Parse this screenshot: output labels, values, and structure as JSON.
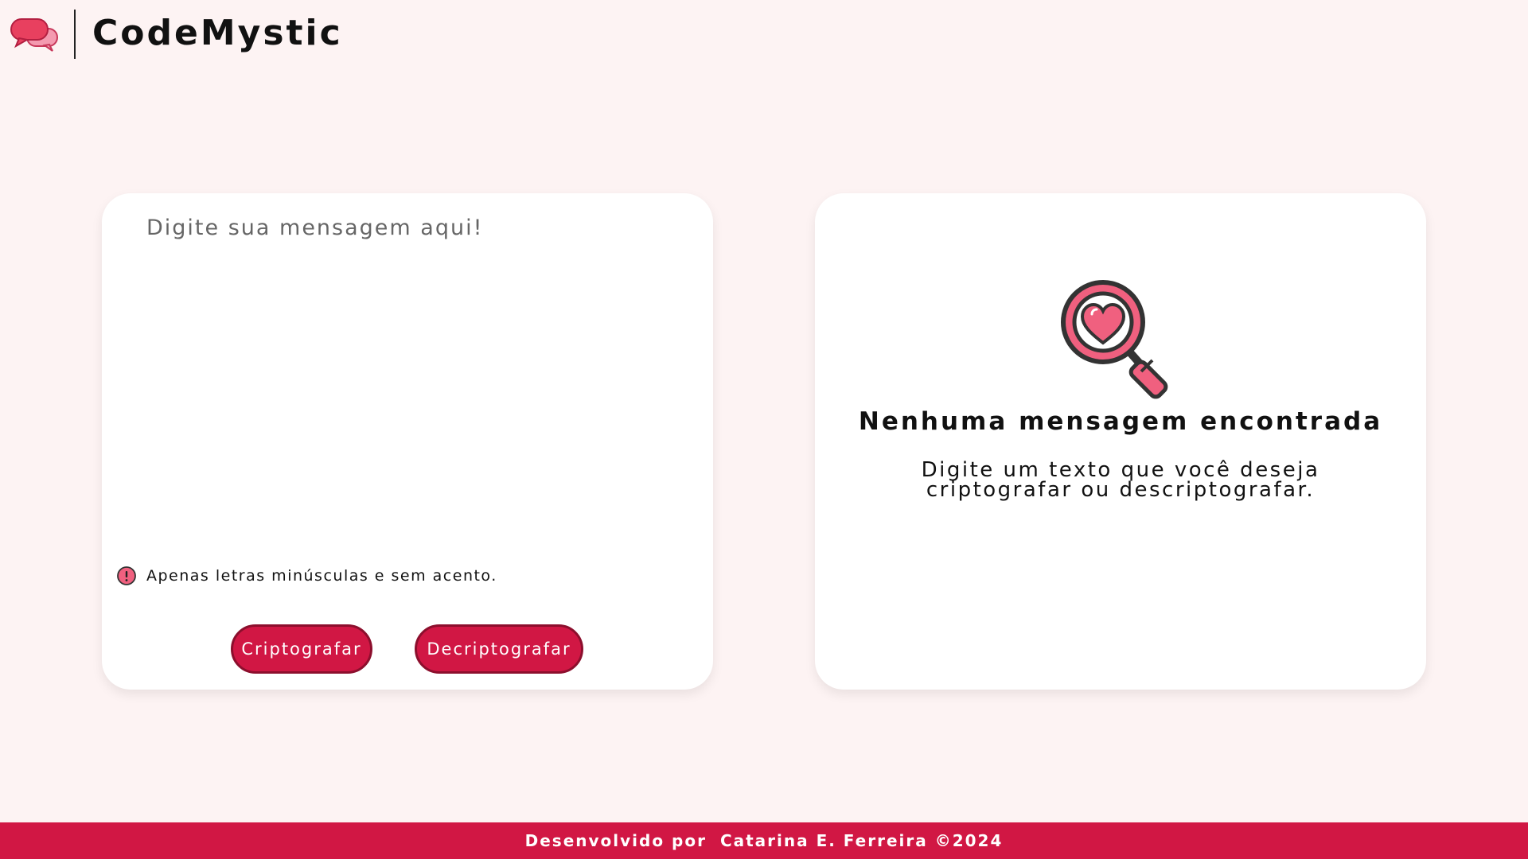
{
  "header": {
    "brand": "CodeMystic",
    "logo_icon": "chat-bubbles-icon"
  },
  "input_card": {
    "placeholder": "Digite sua mensagem aqui!",
    "value": "",
    "hint_icon": "exclamation-circle-icon",
    "hint_text": "Apenas letras minúsculas e sem acento.",
    "encrypt_label": "Criptografar",
    "decrypt_label": "Decriptografar"
  },
  "output_card": {
    "illustration_icon": "magnifier-heart-icon",
    "title": "Nenhuma mensagem encontrada",
    "subtitle": "Digite um texto que você deseja criptografar ou descriptografar."
  },
  "footer": {
    "prefix": "Desenvolvido por",
    "author": "Catarina E. Ferreira ©2024"
  },
  "colors": {
    "background": "#fdf3f3",
    "accent": "#d11744",
    "accent_border": "#8c0f2d",
    "card": "#ffffff",
    "pink": "#f0607f"
  }
}
